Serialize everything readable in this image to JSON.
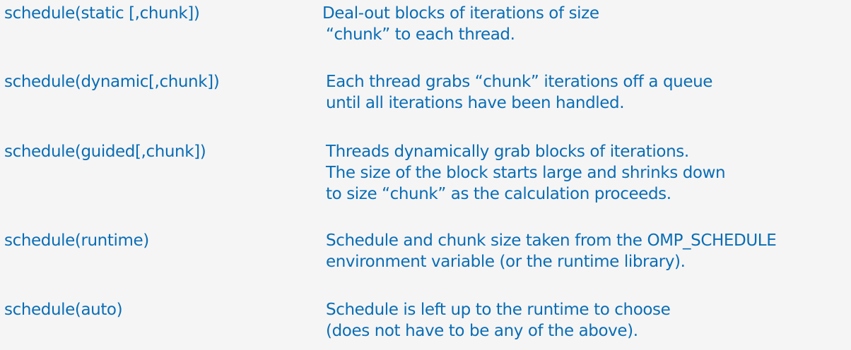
{
  "rows": [
    {
      "clause": "schedule(static [,chunk])",
      "lines": [
        "Deal-out blocks of iterations of size",
        "“chunk” to each thread."
      ]
    },
    {
      "clause": "schedule(dynamic[,chunk])",
      "lines": [
        "Each thread grabs “chunk” iterations off a queue",
        "until all iterations have been handled."
      ]
    },
    {
      "clause": "schedule(guided[,chunk])",
      "lines": [
        "Threads dynamically grab blocks of iterations.",
        "The size of the block starts large and shrinks down",
        "to size “chunk” as the calculation proceeds."
      ]
    },
    {
      "clause": "schedule(runtime)",
      "lines": [
        "Schedule  and chunk size taken from the OMP_SCHEDULE",
        "environment variable (or the runtime library)."
      ]
    },
    {
      "clause": "schedule(auto)",
      "lines": [
        "Schedule is left up to the runtime to choose",
        "(does not have to be any of the above)."
      ]
    }
  ]
}
